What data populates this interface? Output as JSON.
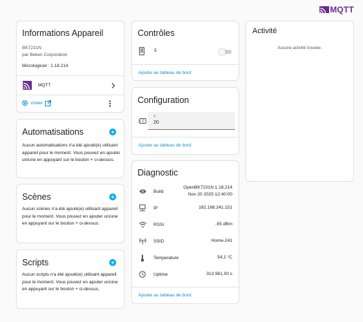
{
  "brand": {
    "logo_text": "MQTT"
  },
  "device_info": {
    "title": "Informations Appareil",
    "model": "BK7231N",
    "manufacturer": "par Beken Corporation",
    "firmware": "Micrologiciel : 1.18.214",
    "integration": {
      "label": "MQTT",
      "icon": "mqtt-icon"
    },
    "visit_label": "Visiter"
  },
  "automations": {
    "title": "Automatisations",
    "description": "Aucun automatisations n'a été ajouté(e) utilisant appareil pour le moment. Vous pouvez en ajouter un/une en appuyant sur le bouton + ci-dessus."
  },
  "scenes": {
    "title": "Scènes",
    "description": "Aucun scènes n'a été ajouté(e) utilisant appareil pour le moment. Vous pouvez en ajouter un/une en appuyant sur le bouton + ci-dessus."
  },
  "scripts": {
    "title": "Scripts",
    "description": "Aucun scripts n'a été ajouté(e) utilisant appareil pour le moment. Vous pouvez en ajouter un/une en appuyant sur le bouton + ci-dessus."
  },
  "controls": {
    "title": "Contrôles",
    "entity_label": "5",
    "switch_on": false,
    "add_label": "Ajouter au tableau de bord"
  },
  "configuration": {
    "title": "Configuration",
    "field_label": "4",
    "field_value": "20",
    "add_label": "Ajouter au tableau de bord"
  },
  "diagnostic": {
    "title": "Diagnostic",
    "rows": [
      {
        "label": "Build",
        "value": "OpenBK7231N 1.18.214\nNov 20 2025 12:40:00",
        "icon": "eye-icon"
      },
      {
        "label": "IP",
        "value": "192.168.241.151",
        "icon": "network-icon"
      },
      {
        "label": "RSSI",
        "value": "-55 dBm",
        "icon": "wifi-icon"
      },
      {
        "label": "SSID",
        "value": "Home-241",
        "icon": "antenna-icon"
      },
      {
        "label": "Temperature",
        "value": "54,1 °C",
        "icon": "thermometer-icon"
      },
      {
        "label": "Uptime",
        "value": "313 961,00 s",
        "icon": "clock-icon"
      }
    ],
    "add_label": "Ajouter au tableau de bord"
  },
  "activity": {
    "title": "Activité",
    "empty_text": "Aucune activité trouvée."
  },
  "colors": {
    "accent": "#03a9f4",
    "link": "#0a8fd0",
    "brand": "#6b2d8f"
  }
}
